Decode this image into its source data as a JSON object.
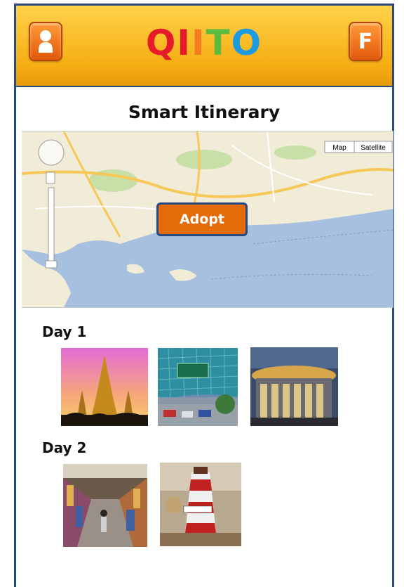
{
  "header": {
    "logo_letters": [
      "Q",
      "I",
      "I",
      "T",
      "O"
    ],
    "profile_icon": "person-icon",
    "right_button_label": "F"
  },
  "page": {
    "title": "Smart Itinerary"
  },
  "map": {
    "controls": {
      "map_label": "Map",
      "satellite_label": "Satellite"
    },
    "adopt_label": "Adopt"
  },
  "itinerary": {
    "days": [
      {
        "label": "Day 1",
        "photos": [
          "temple-photo",
          "mbk-mall-photo",
          "shopping-mall-photo"
        ]
      },
      {
        "label": "Day 2",
        "photos": [
          "market-photo",
          "lighthouse-photo"
        ]
      }
    ]
  },
  "colors": {
    "header": "#f5ad12",
    "accent": "#e36c09",
    "border": "#2a4a7f"
  }
}
